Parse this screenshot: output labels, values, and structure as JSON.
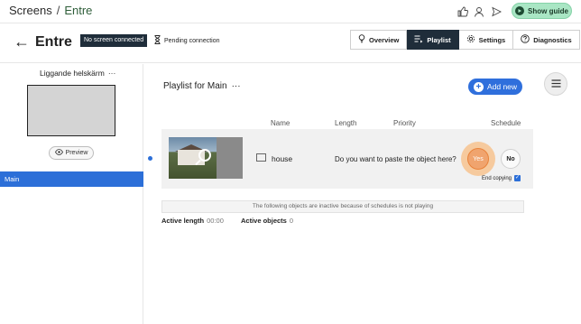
{
  "breadcrumb": {
    "root": "Screens",
    "separator": "/",
    "current": "Entre"
  },
  "topbar": {
    "icons": [
      "thumbs-up-icon",
      "user-icon",
      "send-icon"
    ],
    "guide_label": "Show guide"
  },
  "header": {
    "title": "Entre",
    "status_badge": "No screen connected",
    "pending_label": "Pending connection",
    "tabs": [
      {
        "label": "Overview",
        "icon": "bulb-icon",
        "active": false
      },
      {
        "label": "Playlist",
        "icon": "playlist-icon",
        "active": true
      },
      {
        "label": "Settings",
        "icon": "gear-icon",
        "active": false
      },
      {
        "label": "Diagnostics",
        "icon": "help-icon",
        "active": false
      }
    ]
  },
  "left": {
    "screen_title": "Liggande helskärm",
    "more": "···",
    "preview_label": "Preview",
    "zone_label": "Main"
  },
  "playlist": {
    "title": "Playlist for Main",
    "more": "···",
    "add_label": "Add new",
    "columns": {
      "name": "Name",
      "length": "Length",
      "priority": "Priority",
      "schedule": "Schedule"
    },
    "item": {
      "name": "house",
      "paste_question": "Do you want to paste the object here?",
      "yes_label": "Yes",
      "no_label": "No",
      "end_copying_label": "End copying"
    },
    "inactive_notice": "The following objects are inactive because of schedules is not playing",
    "active_length_label": "Active length",
    "active_length_value": "00:00",
    "active_objects_label": "Active objects",
    "active_objects_value": "0"
  },
  "colors": {
    "accent_blue": "#2c6fd8",
    "dark_navy": "#1f2d3a",
    "guide_green": "#a9e6c4",
    "highlight_orange": "#f0a46e"
  }
}
